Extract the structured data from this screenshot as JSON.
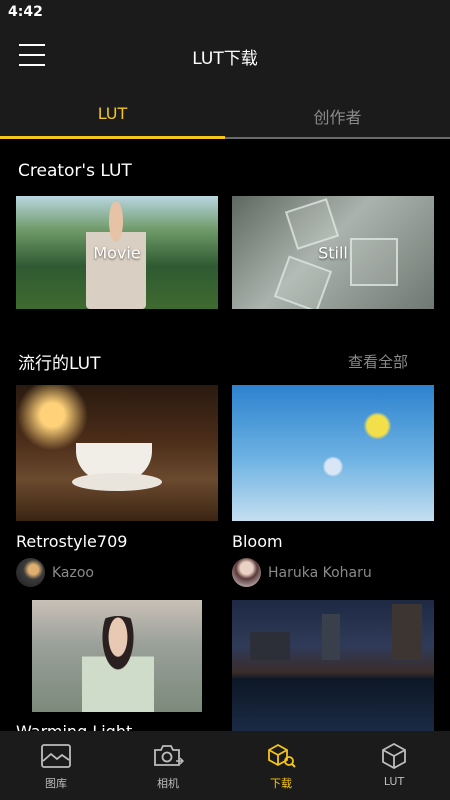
{
  "status_bar": {
    "time": "4:42"
  },
  "header": {
    "title": "LUT下载"
  },
  "tabs": [
    {
      "label": "LUT",
      "active": true
    },
    {
      "label": "创作者",
      "active": false
    }
  ],
  "creators_section": {
    "title": "Creator's LUT",
    "cards": [
      {
        "label": "Movie"
      },
      {
        "label": "Still"
      }
    ]
  },
  "popular_section": {
    "title": "流行的LUT",
    "view_all": "查看全部",
    "items": [
      {
        "title": "Retrostyle709",
        "author": "Kazoo"
      },
      {
        "title": "Bloom",
        "author": "Haruka Koharu"
      },
      {
        "title": "Warming Light",
        "author": ""
      },
      {
        "title": "",
        "author": ""
      }
    ]
  },
  "bottom_nav": [
    {
      "label": "图库",
      "icon": "gallery-icon",
      "active": false
    },
    {
      "label": "相机",
      "icon": "camera-switch-icon",
      "active": false
    },
    {
      "label": "下载",
      "icon": "download-lut-icon",
      "active": true
    },
    {
      "label": "LUT",
      "icon": "lut-cube-icon",
      "active": false
    }
  ],
  "colors": {
    "accent": "#f5c518",
    "background": "#000000",
    "bar": "#1b1b1b",
    "muted": "#8a8a8a"
  }
}
